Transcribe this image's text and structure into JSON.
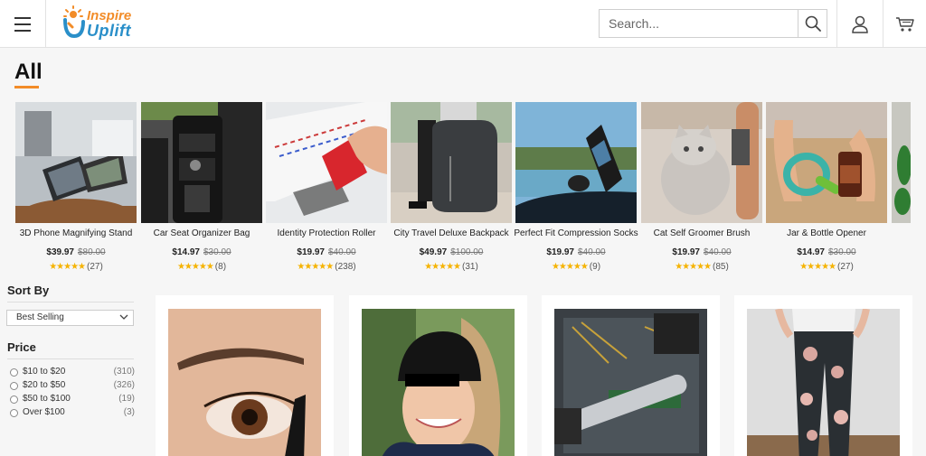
{
  "header": {
    "brand_line1": "Inspire",
    "brand_line2": "Uplift",
    "search_placeholder": "Search..."
  },
  "page_title": "All",
  "colors": {
    "accent": "#f28c28",
    "brand_blue": "#2a8fc9",
    "stars": "#f5b301"
  },
  "carousel": [
    {
      "name": "3D Phone Magnifying Stand",
      "price": "$39.97",
      "old_price": "$80.00",
      "stars": "★★★★★",
      "reviews": "(27)"
    },
    {
      "name": "Car Seat Organizer Bag",
      "price": "$14.97",
      "old_price": "$30.00",
      "stars": "★★★★★",
      "reviews": "(8)"
    },
    {
      "name": "Identity Protection Roller",
      "price": "$19.97",
      "old_price": "$40.00",
      "stars": "★★★★★",
      "reviews": "(238)"
    },
    {
      "name": "City Travel Deluxe Backpack",
      "price": "$49.97",
      "old_price": "$100.00",
      "stars": "★★★★★",
      "reviews": "(31)"
    },
    {
      "name": "Perfect Fit Compression Socks",
      "price": "$19.97",
      "old_price": "$40.00",
      "stars": "★★★★★",
      "reviews": "(9)"
    },
    {
      "name": "Cat Self Groomer Brush",
      "price": "$19.97",
      "old_price": "$40.00",
      "stars": "★★★★★",
      "reviews": "(85)"
    },
    {
      "name": "Jar & Bottle Opener",
      "price": "$14.97",
      "old_price": "$30.00",
      "stars": "★★★★★",
      "reviews": "(27)"
    }
  ],
  "sidebar": {
    "sort_title": "Sort By",
    "sort_value": "Best Selling",
    "price_title": "Price",
    "price_options": [
      {
        "label": "$10 to $20",
        "count": "(310)"
      },
      {
        "label": "$20 to $50",
        "count": "(326)"
      },
      {
        "label": "$50 to $100",
        "count": "(19)"
      },
      {
        "label": "Over $100",
        "count": "(3)"
      }
    ]
  }
}
